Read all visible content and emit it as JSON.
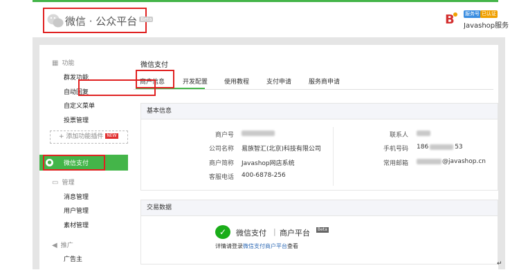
{
  "header": {
    "logo_text": "微信 · 公众平台",
    "beta": "Beta",
    "badge_service": "服务号",
    "badge_verified": "已认证",
    "account_name": "Javashop服务"
  },
  "sidebar": {
    "sections": [
      {
        "label": "功能",
        "icon": "grid-icon",
        "items": [
          "群发功能",
          "自动回复",
          "自定义菜单",
          "投票管理"
        ]
      },
      {
        "label": "管理",
        "icon": "monitor-icon",
        "items": [
          "消息管理",
          "用户管理",
          "素材管理"
        ]
      },
      {
        "label": "推广",
        "icon": "megaphone-icon",
        "items": [
          "广告主"
        ]
      }
    ],
    "add_plugin": "+ 添加功能插件",
    "new_tag": "NEW",
    "active_item": "微信支付"
  },
  "main": {
    "title": "微信支付",
    "tabs": [
      "商户信息",
      "开发配置",
      "使用教程",
      "支付申请",
      "服务商申请"
    ],
    "basic_info": {
      "heading": "基本信息",
      "left": [
        {
          "label": "商户号",
          "value": ""
        },
        {
          "label": "公司名称",
          "value": "易族智汇(北京)科技有限公司"
        },
        {
          "label": "商户简称",
          "value": "Javashop网店系统"
        },
        {
          "label": "客服电话",
          "value": "400-6878-256"
        }
      ],
      "right": [
        {
          "label": "联系人",
          "value": ""
        },
        {
          "label": "手机号码",
          "value_prefix": "186",
          "value_suffix": "53"
        },
        {
          "label": "常用邮箱",
          "value_suffix": "@javashop.cn"
        }
      ]
    },
    "trade": {
      "heading": "交易数据",
      "brand_pay": "微信支付",
      "brand_sep": "|",
      "brand_platform": "商户平台",
      "brand_beta": "Beta",
      "hint_before": "详情请登录",
      "hint_link": "微信支付商户平台",
      "hint_after": "查看"
    }
  },
  "colors": {
    "accent": "#44b549",
    "highlight": "#e02020",
    "link": "#2d69b4"
  },
  "return_mark": "↵"
}
